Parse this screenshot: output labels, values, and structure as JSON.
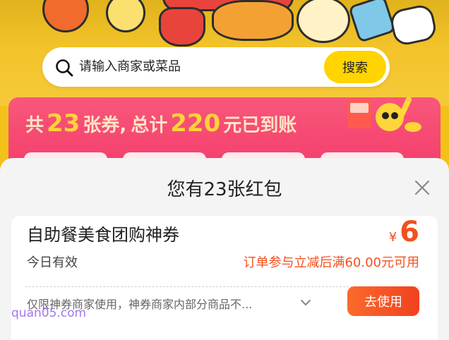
{
  "search": {
    "placeholder": "请输入商家或菜品",
    "button_label": "搜索"
  },
  "coupon_banner": {
    "prefix": "共",
    "count": "23",
    "count_unit": "张券,",
    "total_prefix": "总计",
    "total_amount": "220",
    "total_suffix": "元已到账"
  },
  "sheet": {
    "title": "您有23张红包"
  },
  "coupon_card": {
    "name": "自助餐美食团购神券",
    "currency": "¥",
    "amount": "6",
    "validity": "今日有效",
    "condition": "订单参与立减后满60.00元可用",
    "description": "仅限神券商家使用，神券商家内部分商品不...",
    "use_button_label": "去使用"
  },
  "watermark": "quan05.com",
  "colors": {
    "brand_yellow": "#ffd400",
    "accent_orange": "#f2501f",
    "banner_pink": "#f33a6a",
    "gold_text": "#ffd23a"
  }
}
